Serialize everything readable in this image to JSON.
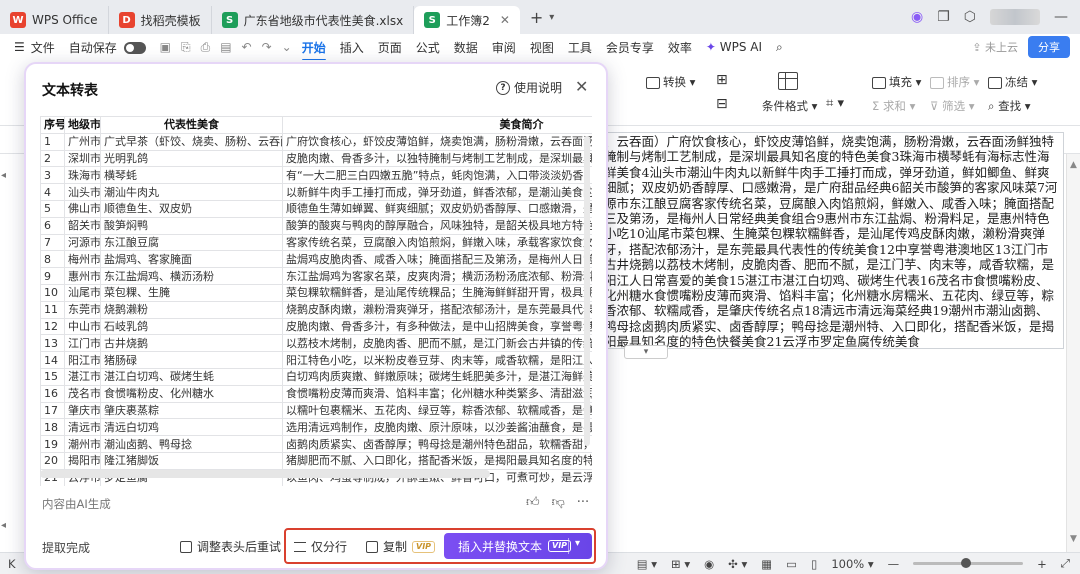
{
  "titlebar": {
    "tabs": [
      {
        "label": "WPS Office",
        "icon": "wps-logo-icon",
        "color": "#e8432f"
      },
      {
        "label": "找稻壳模板",
        "icon": "docer-icon",
        "color": "#e8432f"
      },
      {
        "label": "广东省地级市代表性美食.xlsx",
        "icon": "spreadsheet-icon",
        "color": "#1e9e5a"
      },
      {
        "label": "工作簿2",
        "icon": "spreadsheet-icon",
        "color": "#1e9e5a"
      }
    ],
    "add_tab": "+"
  },
  "menubar": {
    "file": "文件",
    "autosave": "自动保存",
    "items": [
      "开始",
      "插入",
      "页面",
      "公式",
      "数据",
      "审阅",
      "视图",
      "工具",
      "会员专享",
      "效率"
    ],
    "active": "开始",
    "wps_ai": "WPS AI",
    "cloud": "未上云",
    "share": "分享"
  },
  "ribbon": {
    "convert": "转换",
    "cond_format": "条件格式",
    "fill": "填充",
    "sort": "排序",
    "freeze": "冻结",
    "sum": "求和",
    "filter": "筛选",
    "find": "查找"
  },
  "sheet": {
    "text": "、云吞面）广府饮食核心，虾饺皮薄馅鲜，烧卖饱满，肠粉滑嫩，云吞面汤鲜独特腌制与烤制工艺制成，是深圳最具知名度的特色美食3珠海市横琴蚝有海标志性海鲜美食4汕头市潮汕牛肉丸以新鲜牛肉手工捶打而成，弹牙劲道，鲜如鲫鱼、鲜爽细腻；双皮奶奶香醇厚、口感嫩滑，是广府甜品经典6韶关市酸笋的客家风味菜7河源市东江酿豆腐客家传统名菜，豆腐酿入肉馅煎焖，鲜嫩入、咸香入味；腌面搭配三及第汤，是梅州人日常经典美食组合9惠州市东江盐焗、粉滑料足，是惠州特色小吃10汕尾市菜包粿、生腌菜包粿软糯鲜香，是汕尾传鸡皮酥肉嫩，濑粉滑爽弹牙，搭配浓郁汤汁，是东莞最具代表性的传统美食12中享誉粤港澳地区13江门市古井烧鹅以荔枝木烤制，皮脆肉香、肥而不腻，是江门芋、肉末等，咸香软糯，是阳江人日常喜爱的美食15湛江市湛江白切鸡、碳烤生代表16茂名市食惯嘴粉皮、化州糖水食惯嘴粉皮薄而爽滑、馅料丰富；化州糖水房糯米、五花肉、绿豆等，粽香浓郁、软糯咸香，是肇庆传统名点18清远市清远海菜经典19潮州市潮汕卤鹅、鸭母捻卤鹅肉质紧实、卤香醇厚；鸭母捻是潮州特、入口即化，搭配香米饭，是揭阳最具知名度的特色快餐美食21云浮市罗定鱼腐传统美食"
  },
  "statusbar": {
    "zoom": "100%"
  },
  "dialog": {
    "title": "文本转表",
    "help": "使用说明",
    "columns": [
      "序号",
      "地级市",
      "代表性美食",
      "美食简介"
    ],
    "rows": [
      [
        "1",
        "广州市",
        "广式早茶（虾饺、烧卖、肠粉、云吞面）",
        "广府饮食核心，虾饺皮薄馅鲜，烧卖饱满，肠粉滑嫩，云吞面汤鲜"
      ],
      [
        "2",
        "深圳市",
        "光明乳鸽",
        "皮脆肉嫩、骨香多汁，以独特腌制与烤制工艺制成，是深圳最具知"
      ],
      [
        "3",
        "珠海市",
        "横琴蚝",
        "有“一大二肥三白四嫩五脆”特点，蚝肉饱满，入口带淡淡奶香，"
      ],
      [
        "4",
        "汕头市",
        "潮汕牛肉丸",
        "以新鲜牛肉手工捶打而成，弹牙劲道，鲜香浓郁，是潮汕美食的经"
      ],
      [
        "5",
        "佛山市",
        "顺德鱼生、双皮奶",
        "顺德鱼生薄如蝉翼、鲜爽细腻；双皮奶奶香醇厚、口感嫩滑，是广"
      ],
      [
        "6",
        "韶关市",
        "酸笋焖鸭",
        "酸笋的酸爽与鸭肉的醇厚融合，风味独特，是韶关极具地方特色的"
      ],
      [
        "7",
        "河源市",
        "东江酿豆腐",
        "客家传统名菜，豆腐酿入肉馅煎焖，鲜嫩入味，承载客家饮食文化"
      ],
      [
        "8",
        "梅州市",
        "盐焗鸡、客家腌面",
        "盐焗鸡皮脆肉香、咸香入味；腌面搭配三及第汤，是梅州人日常经"
      ],
      [
        "9",
        "惠州市",
        "东江盐焗鸡、横沥汤粉",
        "东江盐焗鸡为客家名菜，皮爽肉滑；横沥汤粉汤底浓郁、粉滑料足，"
      ],
      [
        "10",
        "汕尾市",
        "菜包粿、生腌",
        "菜包粿软糯鲜香，是汕尾传统粿品；生腌海鲜鲜甜开胃，极具潮汕"
      ],
      [
        "11",
        "东莞市",
        "烧鹅濑粉",
        "烧鹅皮酥肉嫩，濑粉滑爽弹牙，搭配浓郁汤汁，是东莞最具代表性"
      ],
      [
        "12",
        "中山市",
        "石岐乳鸽",
        "皮脆肉嫩、骨香多汁，有多种做法，是中山招牌美食，享誉粤港澳"
      ],
      [
        "13",
        "江门市",
        "古井烧鹅",
        "以荔枝木烤制，皮脆肉香、肥而不腻，是江门新会古井镇的传统名"
      ],
      [
        "14",
        "阳江市",
        "猪肠碌",
        "阳江特色小吃，以米粉皮卷豆芽、肉末等，咸香软糯，是阳江人日"
      ],
      [
        "15",
        "湛江市",
        "湛江白切鸡、碳烤生蚝",
        "白切鸡肉质爽嫩、鲜嫩原味；碳烤生蚝肥美多汁，是湛江海鲜美食"
      ],
      [
        "16",
        "茂名市",
        "食惯嘴粉皮、化州糖水",
        "食惯嘴粉皮薄而爽滑、馅料丰富；化州糖水种类繁多、清甜滋润，"
      ],
      [
        "17",
        "肇庆市",
        "肇庆裹蒸粽",
        "以糯叶包裹糯米、五花肉、绿豆等，粽香浓郁、软糯咸香，是肇庆"
      ],
      [
        "18",
        "清远市",
        "清远白切鸡",
        "选用清远鸡制作，皮脆肉嫩、原汁原味，以沙姜酱油蘸食，是粤菜"
      ],
      [
        "19",
        "潮州市",
        "潮汕卤鹅、鸭母捻",
        "卤鹅肉质紧实、卤香醇厚；鸭母捻是潮州特色甜品，软糯香甜，极"
      ],
      [
        "20",
        "揭阳市",
        "隆江猪脚饭",
        "猪脚肥而不腻、入口即化，搭配香米饭，是揭阳最具知名度的特色"
      ],
      [
        "21",
        "云浮市",
        "罗定鱼腐",
        "以鱼肉、鸡蛋等制成，外酥里嫩、鲜香可口，可煮可炒，是云浮罗"
      ]
    ],
    "ai_note": "内容由AI生成",
    "status": "提取完成",
    "adjust": "调整表头后重试",
    "split": "仅分行",
    "copy": "复制",
    "vip": "VIP",
    "insert": "插入并替换文本"
  },
  "colors": {
    "accent": "#1a73e8",
    "primary_button": "#6a45e8",
    "highlight_frame": "#d9402e",
    "sheet_green": "#1e9e5a"
  }
}
